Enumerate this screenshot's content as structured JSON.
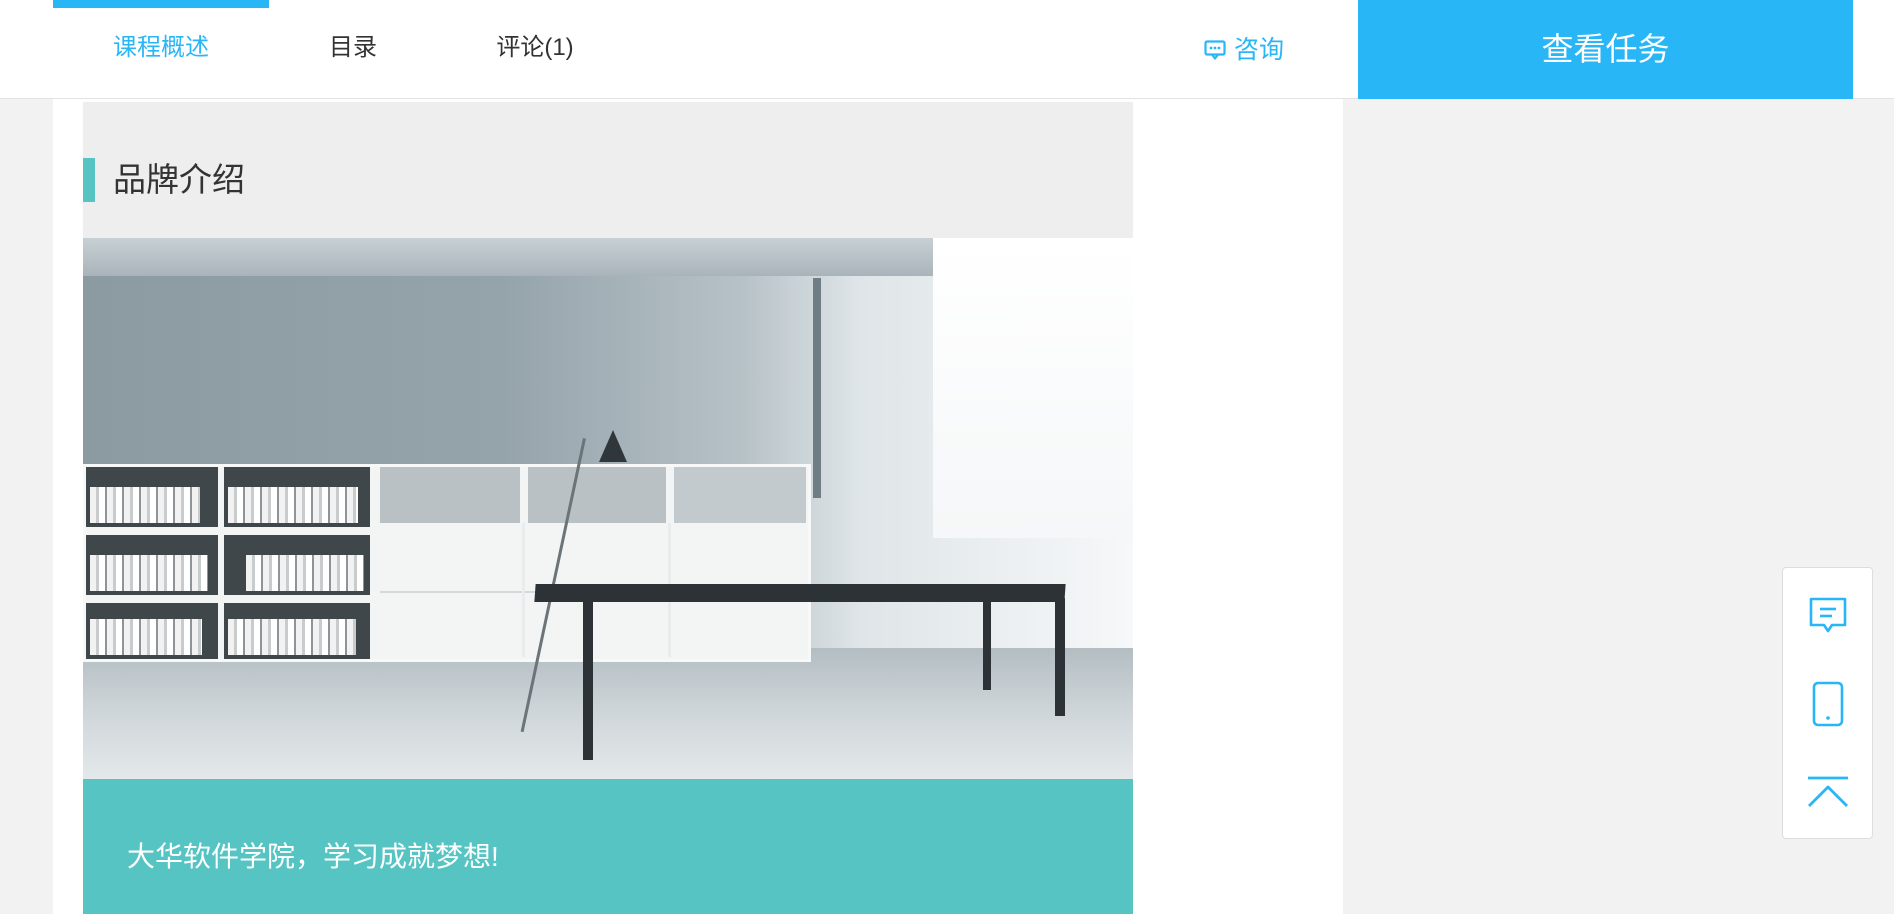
{
  "tabs": [
    {
      "label": "课程概述",
      "active": true
    },
    {
      "label": "目录",
      "active": false
    },
    {
      "label": "评论(1)",
      "active": false
    }
  ],
  "consult": {
    "label": "咨询",
    "icon": "chat-bubble-icon"
  },
  "view_task_button": {
    "label": "查看任务"
  },
  "brand_section": {
    "title": "品牌介绍",
    "caption": "大华软件学院，学习成就梦想!"
  },
  "float_toolbar": {
    "items": [
      {
        "icon": "message-icon"
      },
      {
        "icon": "mobile-phone-icon"
      },
      {
        "icon": "back-to-top-icon"
      }
    ]
  },
  "colors": {
    "accent_blue": "#29b6f6",
    "teal": "#56c4c3",
    "page_bg": "#f2f2f2"
  }
}
